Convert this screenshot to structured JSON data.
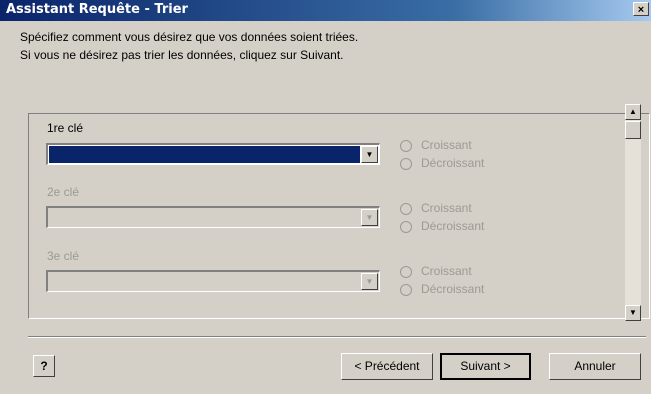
{
  "window": {
    "title": "Assistant Requête - Trier",
    "close_label": "×"
  },
  "intro": {
    "line1": "Spécifiez comment vous désirez que vos données soient triées.",
    "line2": "Si vous ne désirez pas trier les données, cliquez sur Suivant."
  },
  "keys": [
    {
      "label": "1re clé",
      "value": "",
      "asc": "Croissant",
      "desc": "Décroissant",
      "enabled": true
    },
    {
      "label": "2e clé",
      "value": "",
      "asc": "Croissant",
      "desc": "Décroissant",
      "enabled": false
    },
    {
      "label": "3e clé",
      "value": "",
      "asc": "Croissant",
      "desc": "Décroissant",
      "enabled": false
    }
  ],
  "buttons": {
    "help": "?",
    "previous": "< Précédent",
    "next": "Suivant >",
    "cancel": "Annuler"
  },
  "icons": {
    "combo_arrow": "▼",
    "scroll_up": "▲",
    "scroll_down": "▼"
  }
}
